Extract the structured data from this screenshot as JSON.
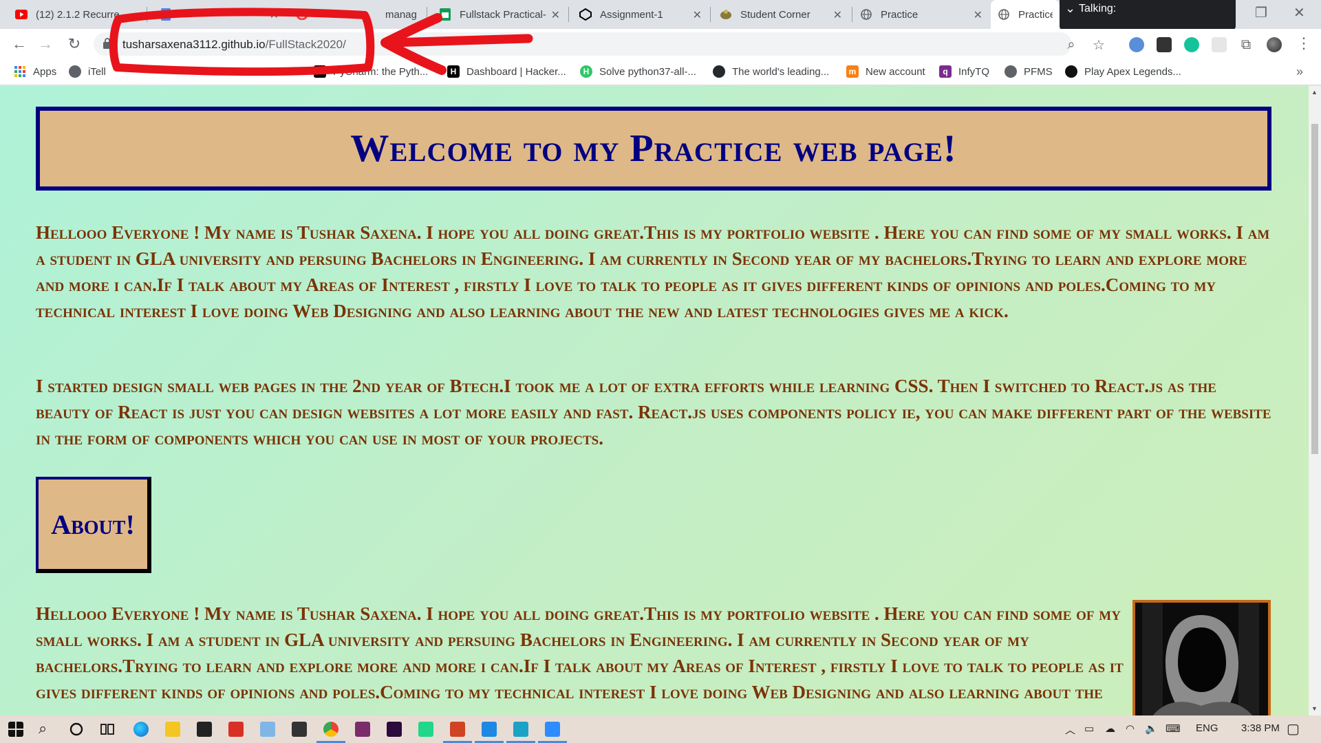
{
  "browser": {
    "tabs": [
      {
        "title": "(12) 2.1.2 Recurre",
        "icon": "youtube-icon",
        "color": "#ff0000"
      },
      {
        "title": "",
        "icon": "docs-icon",
        "color": "#4285f4"
      },
      {
        "title": "manag",
        "icon": "google-icon",
        "color": "#ea4335"
      },
      {
        "title": "Fullstack Practical-",
        "icon": "sheets-icon",
        "color": "#0f9d58"
      },
      {
        "title": "Assignment-1",
        "icon": "codepen-icon",
        "color": "#000000"
      },
      {
        "title": "Student Corner",
        "icon": "student-corner-icon",
        "color": "#8a7a3a"
      },
      {
        "title": "Practice",
        "icon": "globe-icon",
        "color": "#5f6368"
      },
      {
        "title": "Practice",
        "icon": "globe-icon",
        "color": "#5f6368"
      }
    ],
    "talking_label": "Talking:",
    "url_host": "tusharsaxena3112.github.io",
    "url_path": "/FullStack2020/",
    "bookmarks": [
      {
        "label": "Apps",
        "icon": "apps-grid-icon",
        "color": "#4285f4"
      },
      {
        "label": "iTell",
        "icon": "globe-icon",
        "color": "#5f6368"
      },
      {
        "label": "PyCharm: the Pyth...",
        "icon": "pycharm-icon",
        "color": "#000000"
      },
      {
        "label": "Dashboard | Hacker...",
        "icon": "hackerrank-icon",
        "color": "#000000"
      },
      {
        "label": "Solve python37-all-...",
        "icon": "hackerrank-h-icon",
        "color": "#2ec866"
      },
      {
        "label": "The world's leading...",
        "icon": "github-icon",
        "color": "#24292e"
      },
      {
        "label": "New account",
        "icon": "moodle-icon",
        "color": "#f98012"
      },
      {
        "label": "InfyTQ",
        "icon": "infytq-icon",
        "color": "#7b2b8f"
      },
      {
        "label": "PFMS",
        "icon": "globe-icon",
        "color": "#5f6368"
      },
      {
        "label": "Play Apex Legends...",
        "icon": "ea-icon",
        "color": "#111111"
      }
    ]
  },
  "page": {
    "heading": "Welcome to my Practice web page!",
    "para1": "Hellooo Everyone ! My name is Tushar Saxena. I hope you all doing great.This is my portfolio website . Here you can find some of my small works. I am a student in GLA university and persuing Bachelors in Engineering. I am currently in Second year of my bachelors.Trying to learn and explore more and more i can.If I talk about my Areas of Interest , firstly I love to talk to people as it gives different kinds of opinions and poles.Coming to my technical interest I love doing Web Designing and also learning about the new and latest technologies gives me a kick.",
    "para2": "I started design small web pages in the 2nd year of Btech.I took me a lot of extra efforts while learning CSS. Then I switched to React.js as the beauty of React is just you can design websites a lot more easily and fast. React.js uses components policy ie, you can make different part of the website in the form of components which you can use in most of your projects.",
    "about_label": "About!",
    "para3": "Hellooo Everyone ! My name is Tushar Saxena. I hope you all doing great.This is my portfolio website . Here you can find some of my small works. I am a student in GLA university and persuing Bachelors in Engineering. I am currently in Second year of my bachelors.Trying to learn and explore more and more i can.If I talk about my Areas of Interest , firstly I love to talk to people as it gives different kinds of opinions and poles.Coming to my technical interest I love doing Web Designing and also learning about the new and latest technologies gives me a kick."
  },
  "taskbar": {
    "language": "ENG",
    "time": "3:38 PM"
  },
  "colors": {
    "heading_text": "#000080",
    "box_fill": "#deb887",
    "body_text": "#7b3306",
    "annotation": "#e8141b"
  }
}
